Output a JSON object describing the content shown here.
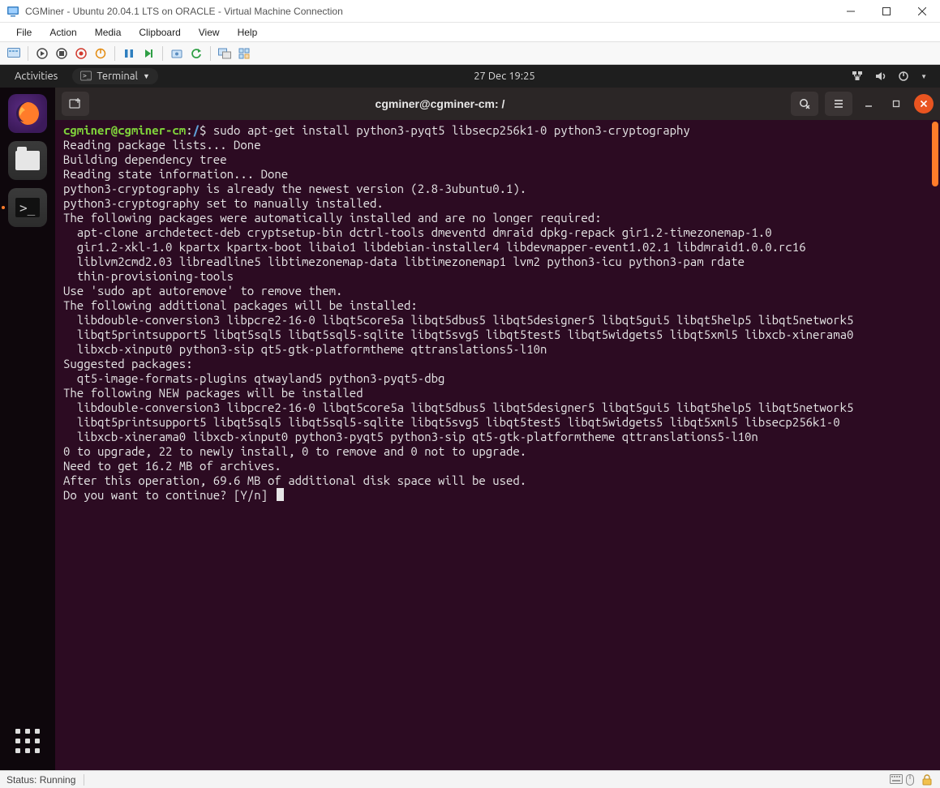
{
  "host": {
    "title": "CGMiner - Ubuntu 20.04.1 LTS on ORACLE - Virtual Machine Connection",
    "menu": [
      "File",
      "Action",
      "Media",
      "Clipboard",
      "View",
      "Help"
    ],
    "status_label": "Status: Running"
  },
  "ubuntu": {
    "activities": "Activities",
    "app_name": "Terminal",
    "clock": "27 Dec  19:25"
  },
  "terminal": {
    "title": "cgminer@cgminer-cm: /",
    "user": "cgminer@cgminer-cm",
    "path": "/",
    "command": "sudo apt-get install python3-pyqt5 libsecp256k1-0 python3-cryptography",
    "lines": [
      "Reading package lists... Done",
      "Building dependency tree",
      "Reading state information... Done",
      "python3-cryptography is already the newest version (2.8-3ubuntu0.1).",
      "python3-cryptography set to manually installed.",
      "The following packages were automatically installed and are no longer required:",
      "  apt-clone archdetect-deb cryptsetup-bin dctrl-tools dmeventd dmraid dpkg-repack gir1.2-timezonemap-1.0",
      "  gir1.2-xkl-1.0 kpartx kpartx-boot libaio1 libdebian-installer4 libdevmapper-event1.02.1 libdmraid1.0.0.rc16",
      "  liblvm2cmd2.03 libreadline5 libtimezonemap-data libtimezonemap1 lvm2 python3-icu python3-pam rdate",
      "  thin-provisioning-tools",
      "Use 'sudo apt autoremove' to remove them.",
      "The following additional packages will be installed:",
      "  libdouble-conversion3 libpcre2-16-0 libqt5core5a libqt5dbus5 libqt5designer5 libqt5gui5 libqt5help5 libqt5network5",
      "  libqt5printsupport5 libqt5sql5 libqt5sql5-sqlite libqt5svg5 libqt5test5 libqt5widgets5 libqt5xml5 libxcb-xinerama0",
      "  libxcb-xinput0 python3-sip qt5-gtk-platformtheme qttranslations5-l10n",
      "Suggested packages:",
      "  qt5-image-formats-plugins qtwayland5 python3-pyqt5-dbg",
      "The following NEW packages will be installed",
      "  libdouble-conversion3 libpcre2-16-0 libqt5core5a libqt5dbus5 libqt5designer5 libqt5gui5 libqt5help5 libqt5network5",
      "  libqt5printsupport5 libqt5sql5 libqt5sql5-sqlite libqt5svg5 libqt5test5 libqt5widgets5 libqt5xml5 libsecp256k1-0",
      "  libxcb-xinerama0 libxcb-xinput0 python3-pyqt5 python3-sip qt5-gtk-platformtheme qttranslations5-l10n",
      "0 to upgrade, 22 to newly install, 0 to remove and 0 not to upgrade.",
      "Need to get 16.2 MB of archives.",
      "After this operation, 69.6 MB of additional disk space will be used.",
      "Do you want to continue? [Y/n] "
    ]
  }
}
